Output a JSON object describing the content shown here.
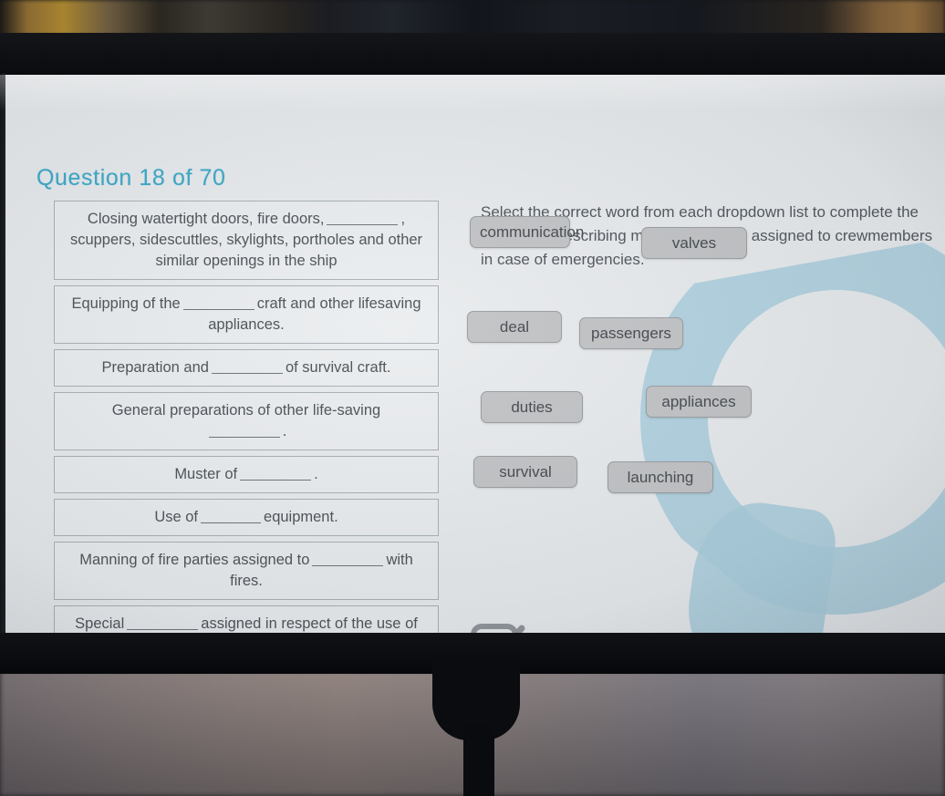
{
  "screen": {
    "question_header": "Question 18 of 70",
    "instructions": "Select the correct word from each dropdown list to complete the sentences describing muster list duties assigned to crewmembers in case of emergencies.",
    "sentences": [
      {
        "id": "closing-watertight-doors",
        "pre": "Closing watertight doors, fire doors,",
        "post": ", scuppers, sidescuttles, skylights, portholes and other similar openings in the ship"
      },
      {
        "id": "equipping-craft",
        "pre": "Equipping of the",
        "post": "craft and other lifesaving appliances."
      },
      {
        "id": "preparation-survival-craft",
        "pre": "Preparation and",
        "post": "of survival craft."
      },
      {
        "id": "general-preparations",
        "pre": "General preparations of other life-saving",
        "post": "."
      },
      {
        "id": "muster-of",
        "pre": "Muster of",
        "post": "."
      },
      {
        "id": "use-of-equipment",
        "pre": "Use of",
        "post": "equipment."
      },
      {
        "id": "manning-fire-parties",
        "pre": "Manning of fire parties assigned to",
        "post": "with fires."
      },
      {
        "id": "special-duties",
        "pre": "Special",
        "post": "assigned in respect of the use of firefighting equipment and installations."
      }
    ],
    "word_options": [
      {
        "id": "communication",
        "label": "communication"
      },
      {
        "id": "valves",
        "label": "valves"
      },
      {
        "id": "deal",
        "label": "deal"
      },
      {
        "id": "passengers",
        "label": "passengers"
      },
      {
        "id": "duties",
        "label": "duties"
      },
      {
        "id": "appliances",
        "label": "appliances"
      },
      {
        "id": "survival",
        "label": "survival"
      },
      {
        "id": "launching",
        "label": "launching"
      }
    ],
    "submit_icon": "checkbox-checked-icon",
    "colors": {
      "title": "#39a9c9",
      "body_text": "#4a5156",
      "screen_background": "#e9ecee",
      "decoration": "#a9cfde",
      "chip_background": "#c3c4c6",
      "chip_border": "#9a9ea1"
    }
  }
}
